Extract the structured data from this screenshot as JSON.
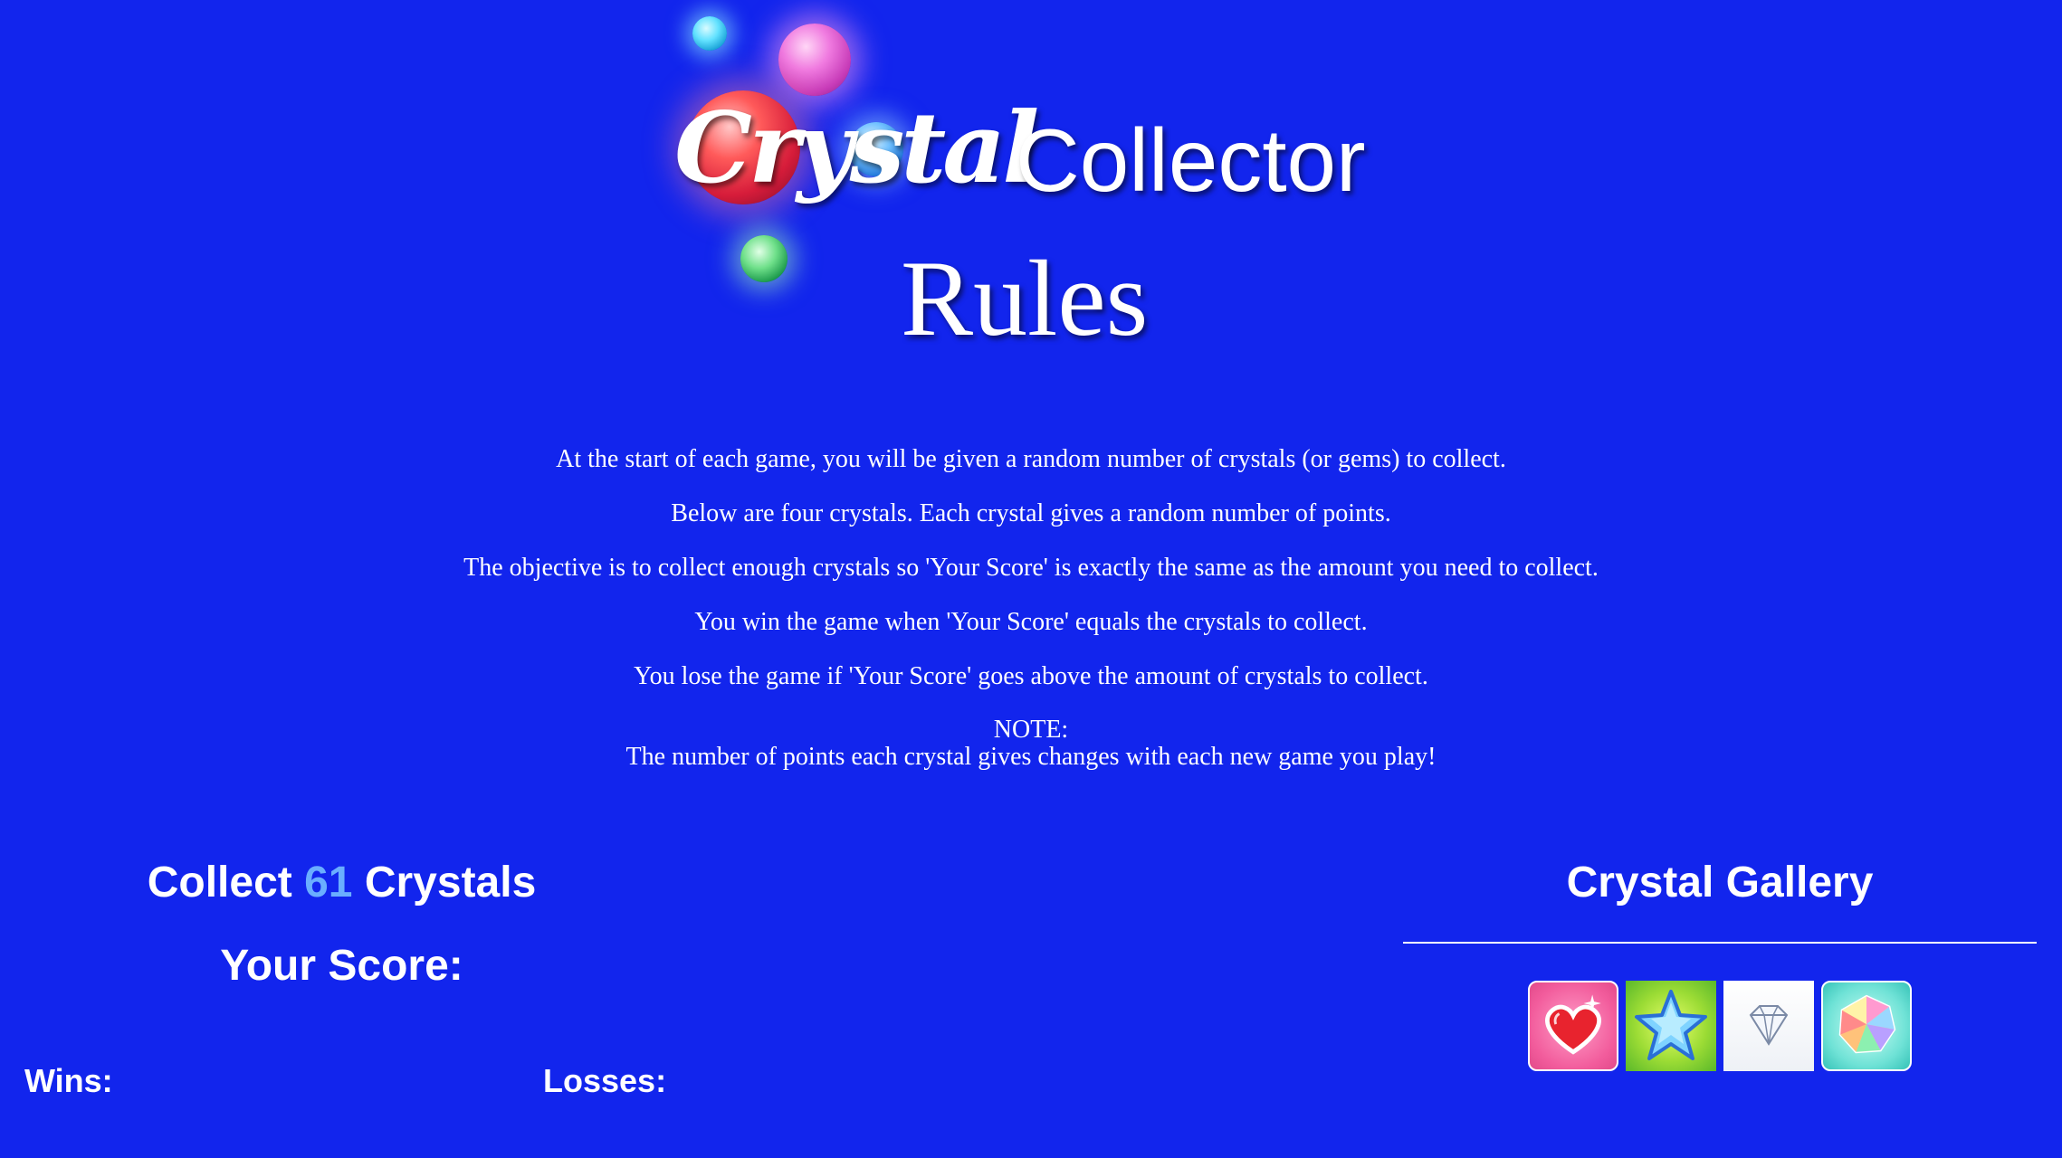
{
  "logo": {
    "script_word": "Crystal",
    "word": "Collector"
  },
  "rules": {
    "heading": "Rules",
    "lines": [
      "At the start of each game, you will be given a random number of crystals (or gems) to collect.",
      "Below are four crystals. Each crystal gives a random number of points.",
      "The objective is to collect enough crystals so 'Your Score' is exactly the same as the amount you need to collect.",
      "You win the game when 'Your Score' equals the crystals to collect.",
      "You lose the game if 'Your Score' goes above the amount of crystals to collect."
    ],
    "note_label": "NOTE:",
    "note_text": "The number of points each crystal gives changes with each new game you play!"
  },
  "game": {
    "collect_prefix": "Collect",
    "target": "61",
    "collect_suffix": "Crystals",
    "score_label": "Your Score:",
    "score_value": "",
    "wins_label": "Wins:",
    "wins_value": "",
    "losses_label": "Losses:",
    "losses_value": ""
  },
  "gallery": {
    "heading": "Crystal Gallery",
    "crystals": [
      {
        "name": "heart-crystal",
        "icon": "heart-icon"
      },
      {
        "name": "star-crystal",
        "icon": "star-icon"
      },
      {
        "name": "diamond-crystal",
        "icon": "diamond-icon"
      },
      {
        "name": "rainbow-crystal",
        "icon": "rainbow-gem-icon"
      }
    ]
  },
  "colors": {
    "background": "#1225ed",
    "text": "#ffffff",
    "target_number": "#6aaeff"
  }
}
